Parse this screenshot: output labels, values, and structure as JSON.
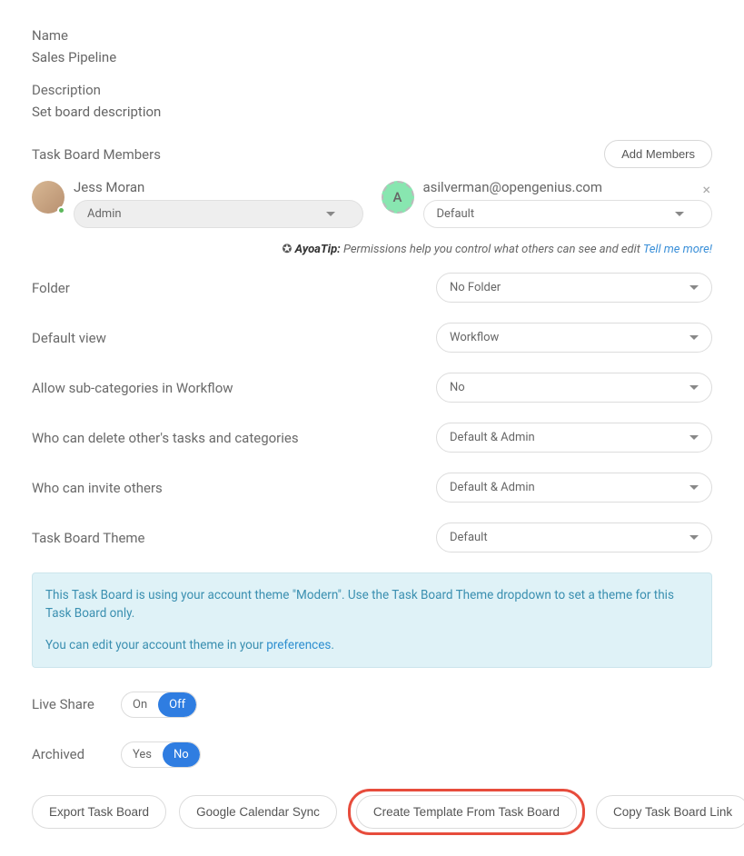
{
  "name": {
    "label": "Name",
    "value": "Sales Pipeline"
  },
  "description": {
    "label": "Description",
    "value": "Set board description"
  },
  "members": {
    "title": "Task Board Members",
    "add_label": "Add Members",
    "list": [
      {
        "name": "Jess Moran",
        "role": "Admin",
        "initial": "",
        "photo": true,
        "removable": false
      },
      {
        "name": "asilverman@opengenius.com",
        "role": "Default",
        "initial": "A",
        "photo": false,
        "removable": true
      }
    ]
  },
  "tip": {
    "label": "AyoaTip:",
    "text": "Permissions help you control what others can see and edit",
    "link": "Tell me more!"
  },
  "settings": {
    "folder": {
      "label": "Folder",
      "value": "No Folder"
    },
    "default_view": {
      "label": "Default view",
      "value": "Workflow"
    },
    "sub_categories": {
      "label": "Allow sub-categories in Workflow",
      "value": "No"
    },
    "delete_perm": {
      "label": "Who can delete other's tasks and categories",
      "value": "Default & Admin"
    },
    "invite_perm": {
      "label": "Who can invite others",
      "value": "Default & Admin"
    },
    "theme": {
      "label": "Task Board Theme",
      "value": "Default"
    }
  },
  "info": {
    "line1": "This Task Board is using your account theme \"Modern\". Use the Task Board Theme dropdown to set a theme for this Task Board only.",
    "line2_prefix": "You can edit your account theme in your ",
    "line2_link": "preferences",
    "line2_suffix": "."
  },
  "live_share": {
    "label": "Live Share",
    "on": "On",
    "off": "Off",
    "active": "Off"
  },
  "archived": {
    "label": "Archived",
    "yes": "Yes",
    "no": "No",
    "active": "No"
  },
  "buttons": {
    "export": "Export Task Board",
    "gcal": "Google Calendar Sync",
    "template": "Create Template From Task Board",
    "copy_link": "Copy Task Board Link"
  }
}
